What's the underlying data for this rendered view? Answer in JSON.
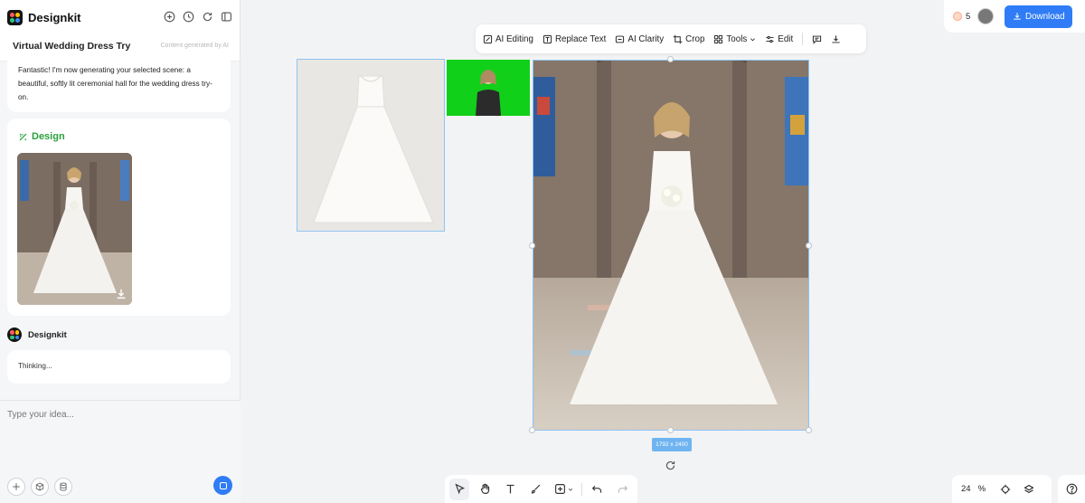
{
  "app": {
    "name": "Designkit",
    "project_title": "Virtual Wedding Dress Try",
    "ai_note": "Content generated by AI"
  },
  "chat": {
    "message_1": "Fantastic! I'm now generating your selected scene: a beautiful, softly lit ceremonial hall for the wedding dress try-on.",
    "design_label": "Design",
    "bot_name": "Designkit",
    "thinking": "Thinking...",
    "input_placeholder": "Type your idea..."
  },
  "toolbar": {
    "ai_editing": "AI Editing",
    "replace_text": "Replace Text",
    "ai_clarity": "AI Clarity",
    "crop": "Crop",
    "tools": "Tools",
    "edit": "Edit"
  },
  "topbar": {
    "credits": "5",
    "download": "Download"
  },
  "canvas": {
    "dimensions": "1792 x 2400"
  },
  "zoom": {
    "value": "24",
    "unit": "%"
  },
  "colors": {
    "accent": "#2f7cf6",
    "design_green": "#28a03c",
    "chroma_green": "#11d01a"
  }
}
